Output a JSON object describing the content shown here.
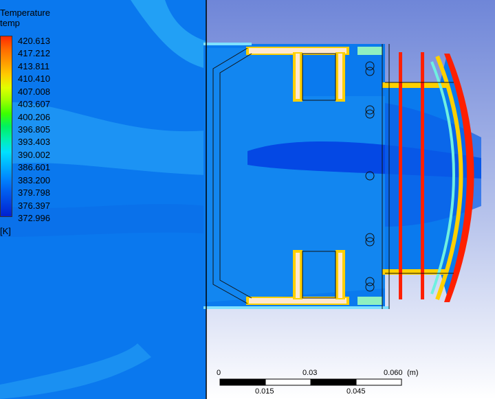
{
  "legend": {
    "title": "Temperature",
    "variable": "temp",
    "units": "[K]",
    "ticks": [
      "420.613",
      "417.212",
      "413.811",
      "410.410",
      "407.008",
      "403.607",
      "400.206",
      "396.805",
      "393.403",
      "390.002",
      "386.601",
      "383.200",
      "379.798",
      "376.397",
      "372.996"
    ],
    "colors": [
      "#ff2a00",
      "#ff6a00",
      "#ff9a00",
      "#ffcc00",
      "#e0ff00",
      "#9cff00",
      "#3cff00",
      "#00f060",
      "#00f0b0",
      "#00e0ff",
      "#00b4ff",
      "#0088ff",
      "#0060f0",
      "#0040e0",
      "#0020d0"
    ]
  },
  "scale_bar": {
    "top_labels": [
      "0",
      "0.03",
      "0.060"
    ],
    "bottom_labels": [
      "0.015",
      "0.045"
    ],
    "unit": "(m)"
  },
  "colors": {
    "field_blue": "#0a78ee",
    "deep_blue": "#0440e4",
    "background_top": "#7a8edc",
    "background_bottom": "#ffffff",
    "hot_red": "#ff2000"
  }
}
